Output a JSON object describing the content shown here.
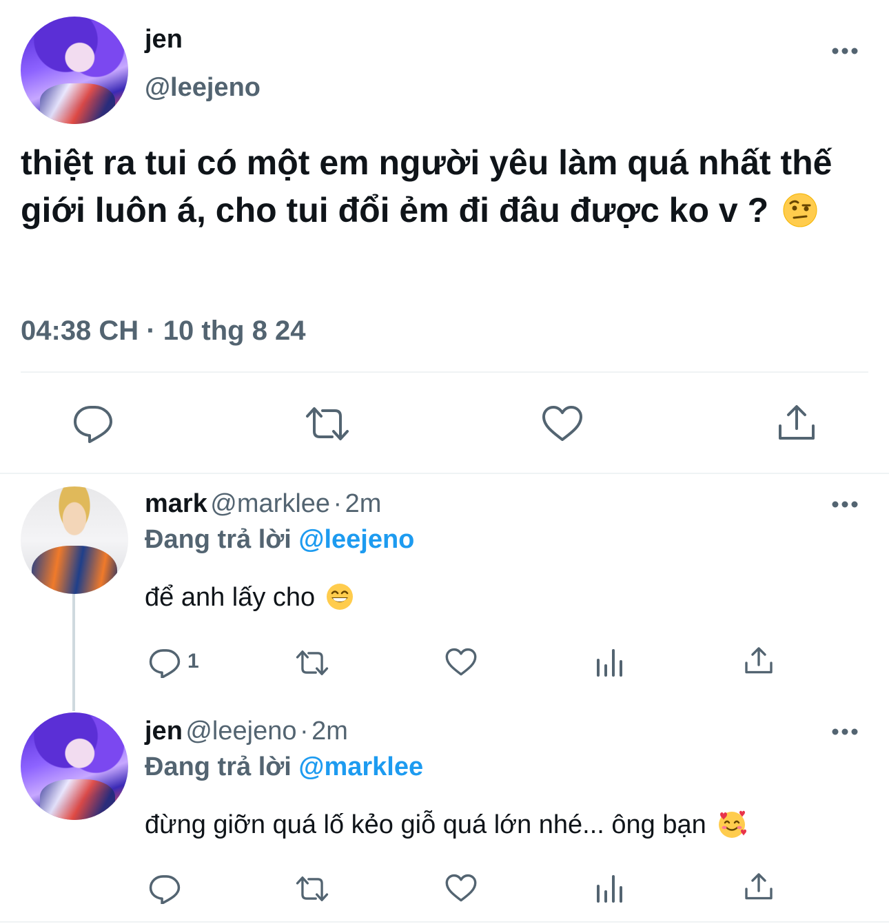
{
  "main_tweet": {
    "name": "jen",
    "handle": "@leejeno",
    "text": "thiệt ra tui có một em người yêu làm quá nhất thế giới luôn á, cho tui đổi ẻm đi đâu được ko v ?",
    "text_emoji": "face-with-raised-eyebrow-emoji",
    "time": "04:38 CH",
    "separator": "·",
    "date": "10 thg 8 24",
    "actions": [
      "reply-icon",
      "retweet-icon",
      "like-icon",
      "share-icon"
    ]
  },
  "replies": [
    {
      "name": "mark",
      "handle": "@marklee",
      "separator": "·",
      "age": "2m",
      "replying_prefix": "Đang trả lời",
      "replying_to": "@leejeno",
      "text": "để anh lấy cho",
      "text_emoji": "grinning-face-emoji",
      "reply_count": "1",
      "actions": [
        "reply-icon",
        "retweet-icon",
        "like-icon",
        "analytics-icon",
        "share-icon"
      ]
    },
    {
      "name": "jen",
      "handle": "@leejeno",
      "separator": "·",
      "age": "2m",
      "replying_prefix": "Đang trả lời",
      "replying_to": "@marklee",
      "text": "đừng giỡn quá lố kẻo giỗ quá lớn nhé... ông bạn",
      "text_emoji": "smiling-face-with-hearts-emoji",
      "actions": [
        "reply-icon",
        "retweet-icon",
        "like-icon",
        "analytics-icon",
        "share-icon"
      ]
    }
  ],
  "colors": {
    "text": "#0f1419",
    "secondary": "#536471",
    "accent": "#1d9bf0",
    "divider": "#eff3f4",
    "thread_line": "#cfd9de"
  }
}
